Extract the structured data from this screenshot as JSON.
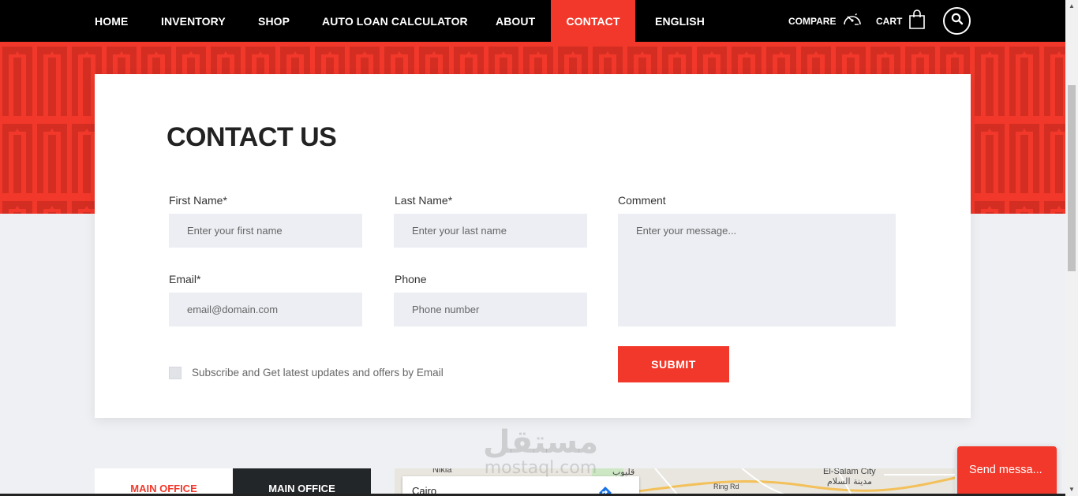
{
  "nav": {
    "items": [
      {
        "label": "HOME"
      },
      {
        "label": "INVENTORY"
      },
      {
        "label": "SHOP"
      },
      {
        "label": "AUTO LOAN CALCULATOR"
      },
      {
        "label": "ABOUT"
      },
      {
        "label": "CONTACT",
        "active": true
      },
      {
        "label": "ENGLISH"
      }
    ],
    "compare_label": "COMPARE",
    "cart_label": "CART",
    "icons": [
      "speedometer-icon",
      "shopping-bag-icon",
      "search-icon"
    ]
  },
  "contact": {
    "title": "CONTACT US",
    "first_name": {
      "label": "First Name*",
      "placeholder": "Enter your first name",
      "value": ""
    },
    "last_name": {
      "label": "Last Name*",
      "placeholder": "Enter your last name",
      "value": ""
    },
    "comment": {
      "label": "Comment",
      "placeholder": "Enter your message...",
      "value": ""
    },
    "email": {
      "label": "Email*",
      "placeholder": "email@domain.com",
      "value": ""
    },
    "phone": {
      "label": "Phone",
      "placeholder": "Phone number",
      "value": ""
    },
    "subscribe_label": "Subscribe and Get latest updates and offers by Email",
    "subscribe_checked": false,
    "submit_label": "SUBMIT"
  },
  "offices": {
    "tabs": [
      {
        "label": "MAIN OFFICE",
        "active": true
      },
      {
        "label": "MAIN OFFICE",
        "active": false
      }
    ]
  },
  "map": {
    "city": "Cairo",
    "labels": [
      "El-Salam City",
      "مدينة السلام",
      "قليوب",
      "Ring Rd",
      "Nikla"
    ]
  },
  "chat": {
    "label": "Send messa..."
  },
  "watermark": {
    "arabic": "مستقل",
    "latin": "mostaql.com"
  },
  "colors": {
    "accent": "#f2382a",
    "nav_bg": "#000000",
    "field_bg": "#eceef3",
    "page_bg": "#eef0f3",
    "dark_tab": "#232628"
  }
}
